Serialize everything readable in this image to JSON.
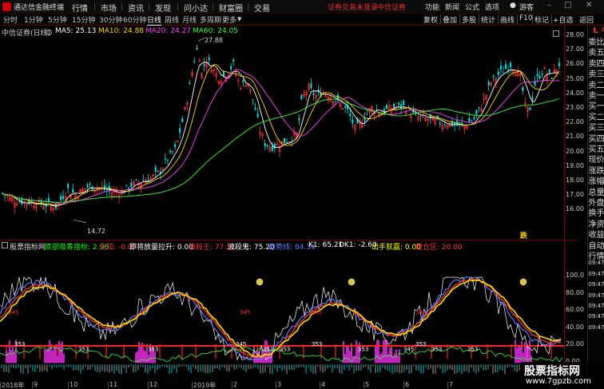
{
  "app": {
    "title": "通达信金融终端"
  },
  "menu": [
    "行情",
    "市场",
    "资讯",
    "发现",
    "问小达",
    "财富圈",
    "交易"
  ],
  "notice": "证券交易未登录",
  "broker": "中信证券",
  "right_menu": [
    "功能",
    "新闻",
    "公式",
    "选项",
    "游客"
  ],
  "periods": [
    "分时",
    "1分钟",
    "5分钟",
    "15分钟",
    "30分钟",
    "60分钟",
    "日线",
    "周线",
    "月线",
    "多周期",
    "更多"
  ],
  "right_tools": [
    "复权",
    "叠加",
    "多股",
    "统计",
    "画线",
    "F10",
    "标记",
    "+自选",
    "返回"
  ],
  "main_legend": {
    "title": "中信证券(日线)",
    "items": [
      {
        "text": "MA5: 25.13",
        "color": "#ffffff"
      },
      {
        "text": "MA10: 24.88",
        "color": "#ffd800"
      },
      {
        "text": "MA20: 24.27",
        "color": "#ff40ff"
      },
      {
        "text": "MA60: 24.05",
        "color": "#33ff33"
      }
    ]
  },
  "price_axis": [
    "28.00",
    "27.00",
    "26.00",
    "25.00",
    "24.00",
    "23.00",
    "22.00",
    "21.00",
    "20.00",
    "19.00",
    "18.00",
    "17.00",
    "16.00"
  ],
  "price_annotations": {
    "high": "27.88",
    "low": "14.72"
  },
  "indicator_legend": {
    "title": "股票指标网",
    "items": [
      {
        "text": "底部吸筹指标: 2.96",
        "color": "#00ff00"
      },
      {
        "text": "先知: -0.07",
        "color": "#ff3333"
      },
      {
        "text": "即将放量拉升: 0.00",
        "color": "#ffffff"
      },
      {
        "text": "波段王: 77.21",
        "color": "#ff3333"
      },
      {
        "text": "波段鬼: 75.20",
        "color": "#ffffff"
      },
      {
        "text": "趋势线: 84.34",
        "color": "#5f7bff"
      },
      {
        "text": "K1: 65.21",
        "color": "#ffffff"
      },
      {
        "text": "DK1: -2.60",
        "color": "#ffffff"
      },
      {
        "text": "出手就赢: 0.00",
        "color": "#ffff00"
      },
      {
        "text": "建仓区: 20.00",
        "color": "#ff3333"
      }
    ]
  },
  "indicator_axis": [
    "100.0",
    "80.00",
    "60.00",
    "40.00",
    "20.00",
    "0.00"
  ],
  "indicator_marks": [
    "353",
    "353",
    "353",
    "345",
    "353",
    "353",
    "353",
    "353",
    "345",
    "353",
    "353",
    "353"
  ],
  "side_panel": [
    "委比",
    "卖五",
    "卖四",
    "卖三",
    "卖二",
    "卖一",
    "买一",
    "买二",
    "买三",
    "买四",
    "买五",
    "现价",
    "涨跌",
    "涨幅",
    "总量",
    "外盘",
    "换手",
    "净资",
    "收益",
    "自动",
    "行情",
    "09:47",
    "09:47",
    "09:47",
    "09:47",
    "09:47",
    "09:47",
    "09:47"
  ],
  "side_flags": [
    "L",
    "A"
  ],
  "dates": [
    "2018年",
    "9",
    "10",
    "11",
    "12",
    "2019年",
    "2",
    "3",
    "4",
    "5",
    "6",
    "7"
  ],
  "watermark": {
    "line1": "股票指标网",
    "line2": "www.7gpzb.com"
  },
  "special_labels": [
    "跌"
  ]
}
